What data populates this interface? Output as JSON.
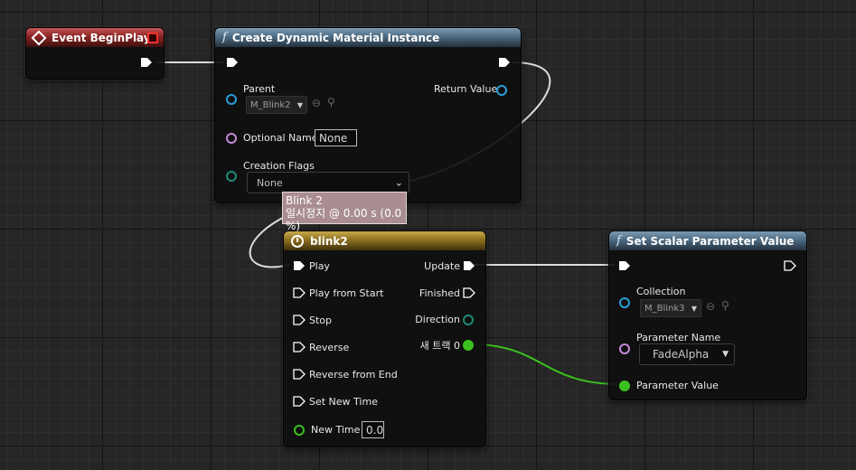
{
  "colors": {
    "exec_wire": "#dcdcdc",
    "float_wire": "#3bc01e",
    "object_pin": "#2a9fd8",
    "name_pin": "#c58ad8",
    "struct_pin": "#1e8a7a",
    "float_pin": "#3bc01e"
  },
  "event_node": {
    "title": "Event BeginPlay"
  },
  "cdmi_node": {
    "title": "Create Dynamic Material Instance",
    "parent_label": "Parent",
    "parent_value": "M_Blink2",
    "return_label": "Return Value",
    "optional_name_label": "Optional Name",
    "optional_name_value": "None",
    "creation_flags_label": "Creation Flags",
    "creation_flags_value": "None"
  },
  "tooltip": {
    "line1": "Blink 2",
    "line2": "일시정지 @ 0.00 s (0.0 %)"
  },
  "timeline_node": {
    "title": "blink2",
    "inputs": [
      "Play",
      "Play from Start",
      "Stop",
      "Reverse",
      "Reverse from End",
      "Set New Time"
    ],
    "new_time_label": "New Time",
    "new_time_value": "0.0",
    "outputs": {
      "update": "Update",
      "finished": "Finished",
      "direction": "Direction",
      "track": "새 트랙 0"
    }
  },
  "ssp_node": {
    "title": "Set Scalar Parameter Value",
    "collection_label": "Collection",
    "collection_value": "M_Blink3",
    "param_name_label": "Parameter Name",
    "param_name_value": "FadeAlpha",
    "param_value_label": "Parameter Value"
  }
}
